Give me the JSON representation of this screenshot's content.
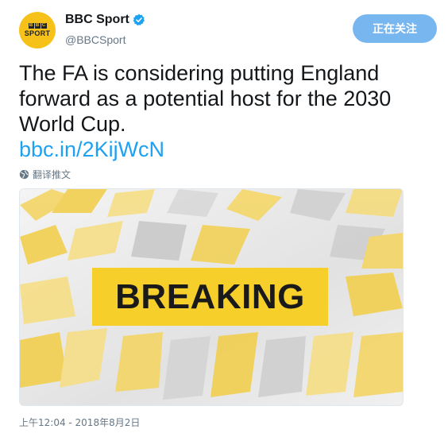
{
  "account": {
    "display_name": "BBC Sport",
    "handle": "@BBCSport",
    "avatar_letters": [
      "B",
      "B",
      "C"
    ],
    "avatar_sport": "SPORT",
    "verified_icon": "verified-badge-icon"
  },
  "follow_button": {
    "label": "正在关注"
  },
  "tweet": {
    "text": "The FA is considering putting England forward as a potential host for the 2030 World Cup.",
    "link": "bbc.in/2KijWcN",
    "translate_label": "翻译推文"
  },
  "media": {
    "banner_text": "BREAKING"
  },
  "timestamp": "上午12:04 - 2018年8月2日",
  "colors": {
    "accent": "#1da1f2",
    "follow_button": "#78b6f0",
    "brand_yellow": "#f6cf2a"
  }
}
